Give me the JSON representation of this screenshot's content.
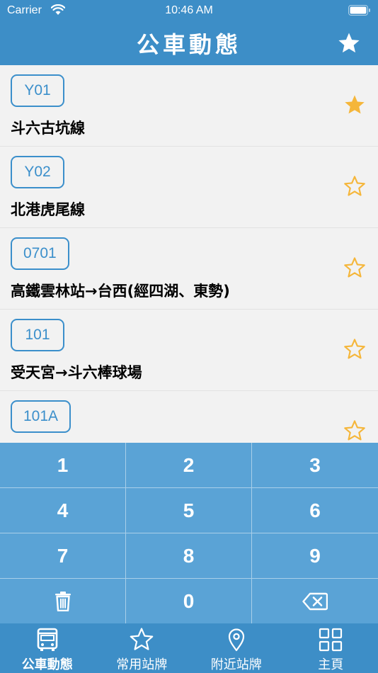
{
  "status_bar": {
    "carrier": "Carrier",
    "time": "10:46 AM"
  },
  "header": {
    "title": "公車動態"
  },
  "routes": [
    {
      "code": "Y01",
      "name": "斗六古坑線",
      "favorite": true
    },
    {
      "code": "Y02",
      "name": "北港虎尾線",
      "favorite": false
    },
    {
      "code": "0701",
      "name": "高鐵雲林站→台西(經四湖、東勢)",
      "favorite": false
    },
    {
      "code": "101",
      "name": "受天宮→斗六棒球場",
      "favorite": false
    },
    {
      "code": "101A",
      "name": "",
      "favorite": false
    }
  ],
  "keypad": {
    "keys": [
      "1",
      "2",
      "3",
      "4",
      "5",
      "6",
      "7",
      "8",
      "9",
      "0"
    ],
    "clear_icon": "trash-icon",
    "backspace_icon": "backspace-icon"
  },
  "tabs": [
    {
      "label": "公車動態",
      "icon": "bus-icon",
      "active": true
    },
    {
      "label": "常用站牌",
      "icon": "star-outline-icon",
      "active": false
    },
    {
      "label": "附近站牌",
      "icon": "location-pin-icon",
      "active": false
    },
    {
      "label": "主頁",
      "icon": "grid-icon",
      "active": false
    }
  ],
  "colors": {
    "primary": "#3d8ec7",
    "keypad": "#5aa3d6",
    "badge": "#3b8fcb",
    "star": "#f5b63a",
    "list_bg": "#f2f2f2"
  }
}
